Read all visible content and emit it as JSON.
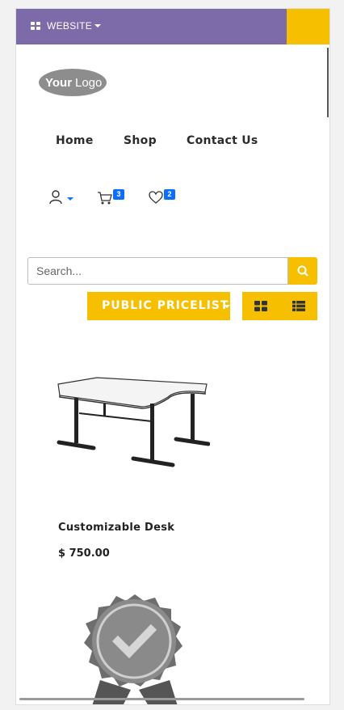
{
  "topbar": {
    "website_label": "WEBSITE",
    "color": "#7d6aa9",
    "accent": "#f6c000"
  },
  "logo": {
    "text_your": "Your",
    "text_logo": "Logo",
    "icon": "logo"
  },
  "nav": {
    "items": [
      "Home",
      "Shop",
      "Contact Us"
    ]
  },
  "header_icons": {
    "user_icon": "user-icon",
    "cart_count": "3",
    "wishlist_count": "2"
  },
  "search": {
    "placeholder": "Search...",
    "icon": "search-icon"
  },
  "pricelist": {
    "label": "PUBLIC PRICELIST"
  },
  "view_switcher": {
    "grid_icon": "grid-icon",
    "list_icon": "list-icon"
  },
  "products": [
    {
      "name": "Customizable Desk",
      "price": "$ 750.00",
      "image": "desk-image"
    },
    {
      "name": "",
      "price": "",
      "image": "badge-image"
    }
  ],
  "colors": {
    "badge_blue": "#0d6efd",
    "brand_yellow": "#f6c000"
  }
}
